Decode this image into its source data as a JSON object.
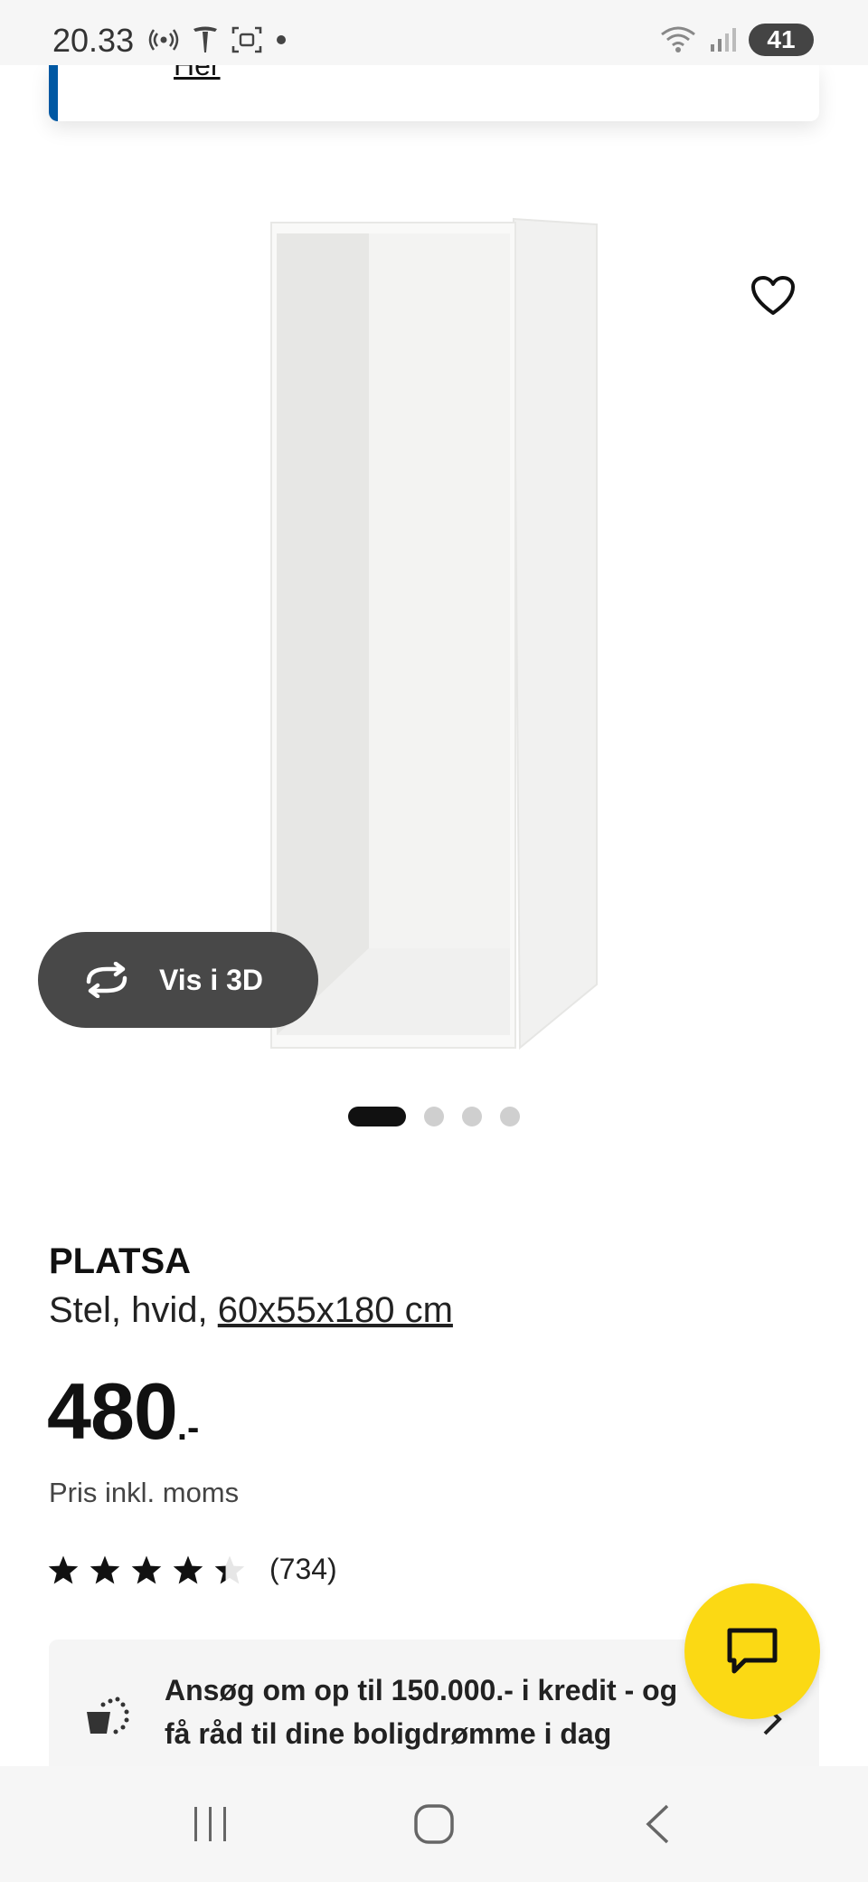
{
  "status_bar": {
    "time": "20.33",
    "battery": "41"
  },
  "banner": {
    "link_text": "Her"
  },
  "media": {
    "view_3d_label": "Vis i 3D",
    "carousel_dots": 4,
    "active_dot": 0
  },
  "product": {
    "name": "PLATSA",
    "description_prefix": "Stel, hvid, ",
    "dimensions": "60x55x180 cm",
    "price_integer": "480",
    "price_suffix": ".-",
    "price_note": "Pris inkl. moms",
    "rating_value": 4.4,
    "rating_max": 5,
    "rating_count": "(734)"
  },
  "credit_banner": {
    "text": "Ansøg om op til 150.000.- i kredit - og få råd til dine boligdrømme i dag"
  },
  "colors": {
    "accent_blue": "#0058a3",
    "fab_yellow": "#fbd914",
    "view3d_bg": "#484848"
  },
  "icons": {
    "favorite": "heart-outline-icon",
    "view_3d": "rotate-3d-icon",
    "chat": "chat-bubble-icon",
    "credit": "credit-cart-icon",
    "chevron": "chevron-right-icon"
  }
}
